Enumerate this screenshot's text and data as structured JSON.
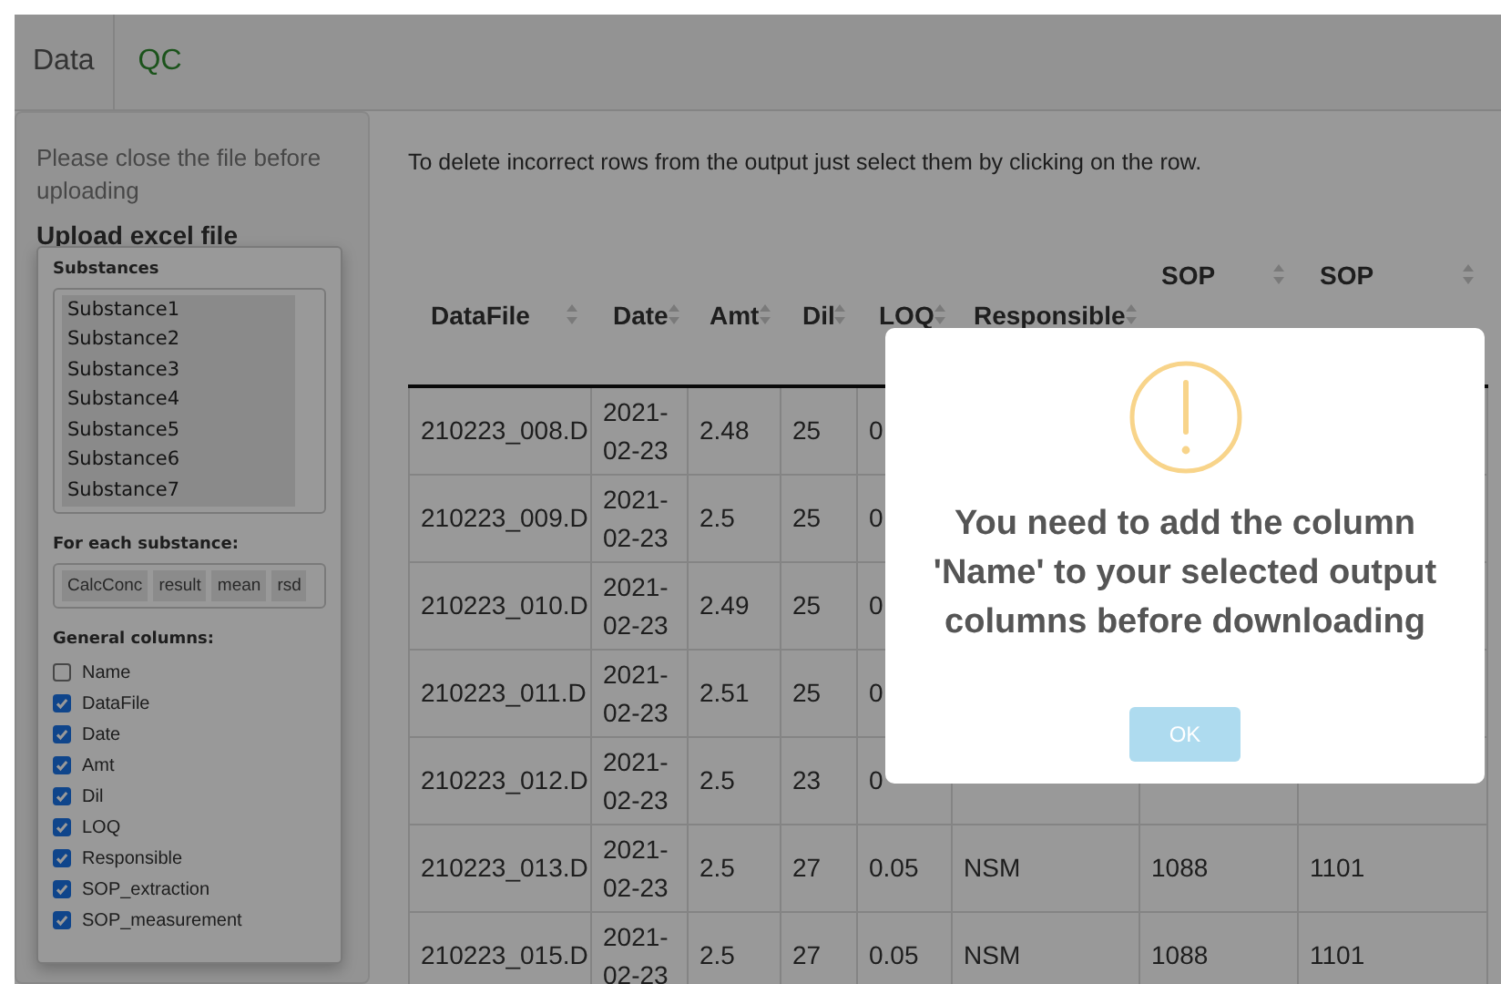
{
  "tabs": [
    {
      "label": "Data",
      "selected": true
    },
    {
      "label": "QC",
      "selected": false
    }
  ],
  "sidebar": {
    "notice": "Please close the file before uploading",
    "upload_label": "Upload excel file"
  },
  "column_picker": {
    "substances_label": "Substances",
    "substances": [
      "Substance1",
      "Substance2",
      "Substance3",
      "Substance4",
      "Substance5",
      "Substance6",
      "Substance7"
    ],
    "per_substance_label": "For each substance:",
    "per_substance": [
      "CalcConc",
      "result",
      "mean",
      "rsd"
    ],
    "general_label": "General columns:",
    "general_columns": [
      {
        "label": "Name",
        "checked": false
      },
      {
        "label": "DataFile",
        "checked": true
      },
      {
        "label": "Date",
        "checked": true
      },
      {
        "label": "Amt",
        "checked": true
      },
      {
        "label": "Dil",
        "checked": true
      },
      {
        "label": "LOQ",
        "checked": true
      },
      {
        "label": "Responsible",
        "checked": true
      },
      {
        "label": "SOP_extraction",
        "checked": true
      },
      {
        "label": "SOP_measurement",
        "checked": true
      }
    ]
  },
  "instructions": "To delete incorrect rows from the output just select them by clicking on the row.",
  "table": {
    "columns": [
      "DataFile",
      "Date",
      "Amt",
      "Dil",
      "LOQ",
      "Responsible",
      "SOP",
      "SOP"
    ],
    "rows": [
      [
        "210223_008.D",
        "2021-02-23",
        "2.48",
        "25",
        "0"
      ],
      [
        "210223_009.D",
        "2021-02-23",
        "2.5",
        "25",
        "0"
      ],
      [
        "210223_010.D",
        "2021-02-23",
        "2.49",
        "25",
        "0"
      ],
      [
        "210223_011.D",
        "2021-02-23",
        "2.51",
        "25",
        "0"
      ],
      [
        "210223_012.D",
        "2021-02-23",
        "2.5",
        "23",
        "0"
      ],
      [
        "210223_013.D",
        "2021-02-23",
        "2.5",
        "27",
        "0.05",
        "NSM",
        "1088",
        "1101"
      ],
      [
        "210223_015.D",
        "2021-02-23",
        "2.5",
        "27",
        "0.05",
        "NSM",
        "1088",
        "1101"
      ]
    ]
  },
  "alert": {
    "message": "You need to add the column 'Name' to your selected output columns before downloading",
    "button": "OK"
  }
}
